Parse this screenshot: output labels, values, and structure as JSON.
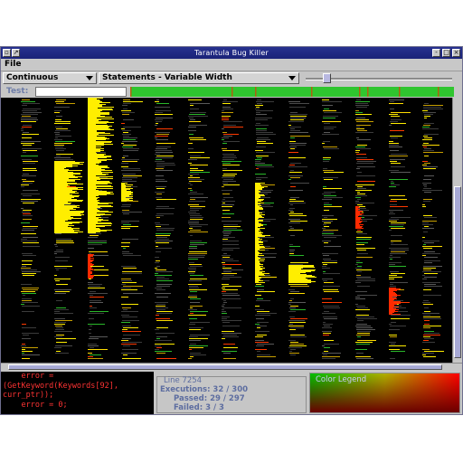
{
  "window": {
    "title": "Tarantula Bug Killer"
  },
  "menu": {
    "file": "File"
  },
  "toolbar": {
    "mode": "Continuous",
    "display": "Statements - Variable Width"
  },
  "test": {
    "label": "Test:",
    "value": ""
  },
  "source": {
    "lines": [
      "    error =",
      "(GetKeyword(Keywords[92],",
      "curr_ptr));",
      "    error = 0;"
    ]
  },
  "info": {
    "title": "Line 7254",
    "executions": "Executions: 32 / 300",
    "passed": "Passed: 29 / 297",
    "failed": "Failed: 3 / 3"
  },
  "legend": {
    "title": "Color Legend"
  },
  "colors": {
    "pass": "#22b822",
    "fail": "#ff2a00",
    "suspicious": "#ffee00",
    "neutral": "#5a5a5a",
    "test_bar": "#2fc52f"
  }
}
